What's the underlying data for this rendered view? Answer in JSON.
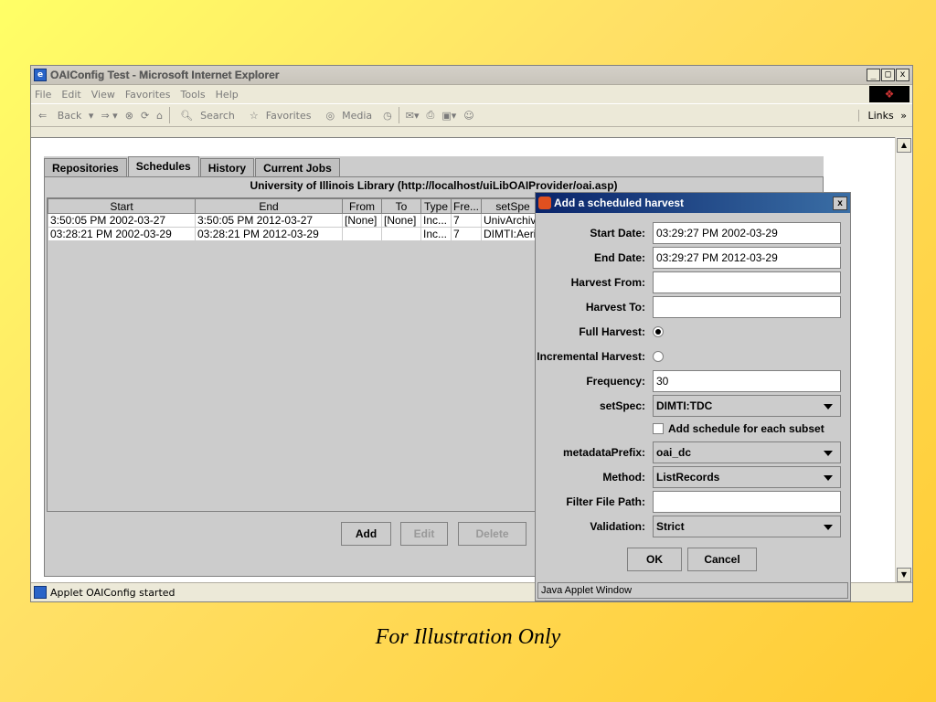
{
  "window": {
    "title": "OAIConfig Test - Microsoft Internet Explorer",
    "controls": [
      "_",
      "□",
      "x"
    ]
  },
  "menu": [
    "File",
    "Edit",
    "View",
    "Favorites",
    "Tools",
    "Help"
  ],
  "toolbar": {
    "back": "Back",
    "search": "Search",
    "favorites": "Favorites",
    "media": "Media",
    "links": "Links"
  },
  "status_bar": {
    "text": "Applet OAIConfig started"
  },
  "applet": {
    "tabs": [
      "Repositories",
      "Schedules",
      "History",
      "Current Jobs"
    ],
    "active_tab": "Schedules",
    "panel_title": "University of Illinois Library (http://localhost/uiLibOAIProvider/oai.asp)",
    "table": {
      "columns": [
        "Start",
        "End",
        "From",
        "To",
        "Type",
        "Fre...",
        "setSpe"
      ],
      "rows": [
        [
          "3:50:05 PM 2002-03-27",
          "3:50:05 PM 2012-03-27",
          "[None]",
          "[None]",
          "Inc...",
          "7",
          "UnivArchive"
        ],
        [
          "03:28:21 PM 2002-03-29",
          "03:28:21 PM 2012-03-29",
          "",
          "",
          "Inc...",
          "7",
          "DIMTI:Aeria"
        ]
      ]
    },
    "buttons": {
      "add": "Add",
      "edit": "Edit",
      "delete": "Delete"
    }
  },
  "dialog": {
    "title": "Add a scheduled harvest",
    "close": "x",
    "fields": {
      "start_date": {
        "label": "Start Date:",
        "value": "03:29:27 PM 2002-03-29"
      },
      "end_date": {
        "label": "End Date:",
        "value": "03:29:27 PM 2012-03-29"
      },
      "harvest_from": {
        "label": "Harvest From:",
        "value": ""
      },
      "harvest_to": {
        "label": "Harvest To:",
        "value": ""
      },
      "full_harvest": {
        "label": "Full Harvest:",
        "selected": true
      },
      "incremental_harvest": {
        "label": "Incremental Harvest:",
        "selected": false
      },
      "frequency": {
        "label": "Frequency:",
        "value": "30"
      },
      "setspec": {
        "label": "setSpec:",
        "value": "DIMTI:TDC"
      },
      "subset_checkbox": {
        "label": "Add schedule for each subset",
        "checked": false
      },
      "metadata_prefix": {
        "label": "metadataPrefix:",
        "value": "oai_dc"
      },
      "method": {
        "label": "Method:",
        "value": "ListRecords"
      },
      "filter_file_path": {
        "label": "Filter File Path:",
        "value": ""
      },
      "validation": {
        "label": "Validation:",
        "value": "Strict"
      }
    },
    "ok": "OK",
    "cancel": "Cancel",
    "status": "Java Applet Window"
  },
  "caption": "For Illustration Only"
}
